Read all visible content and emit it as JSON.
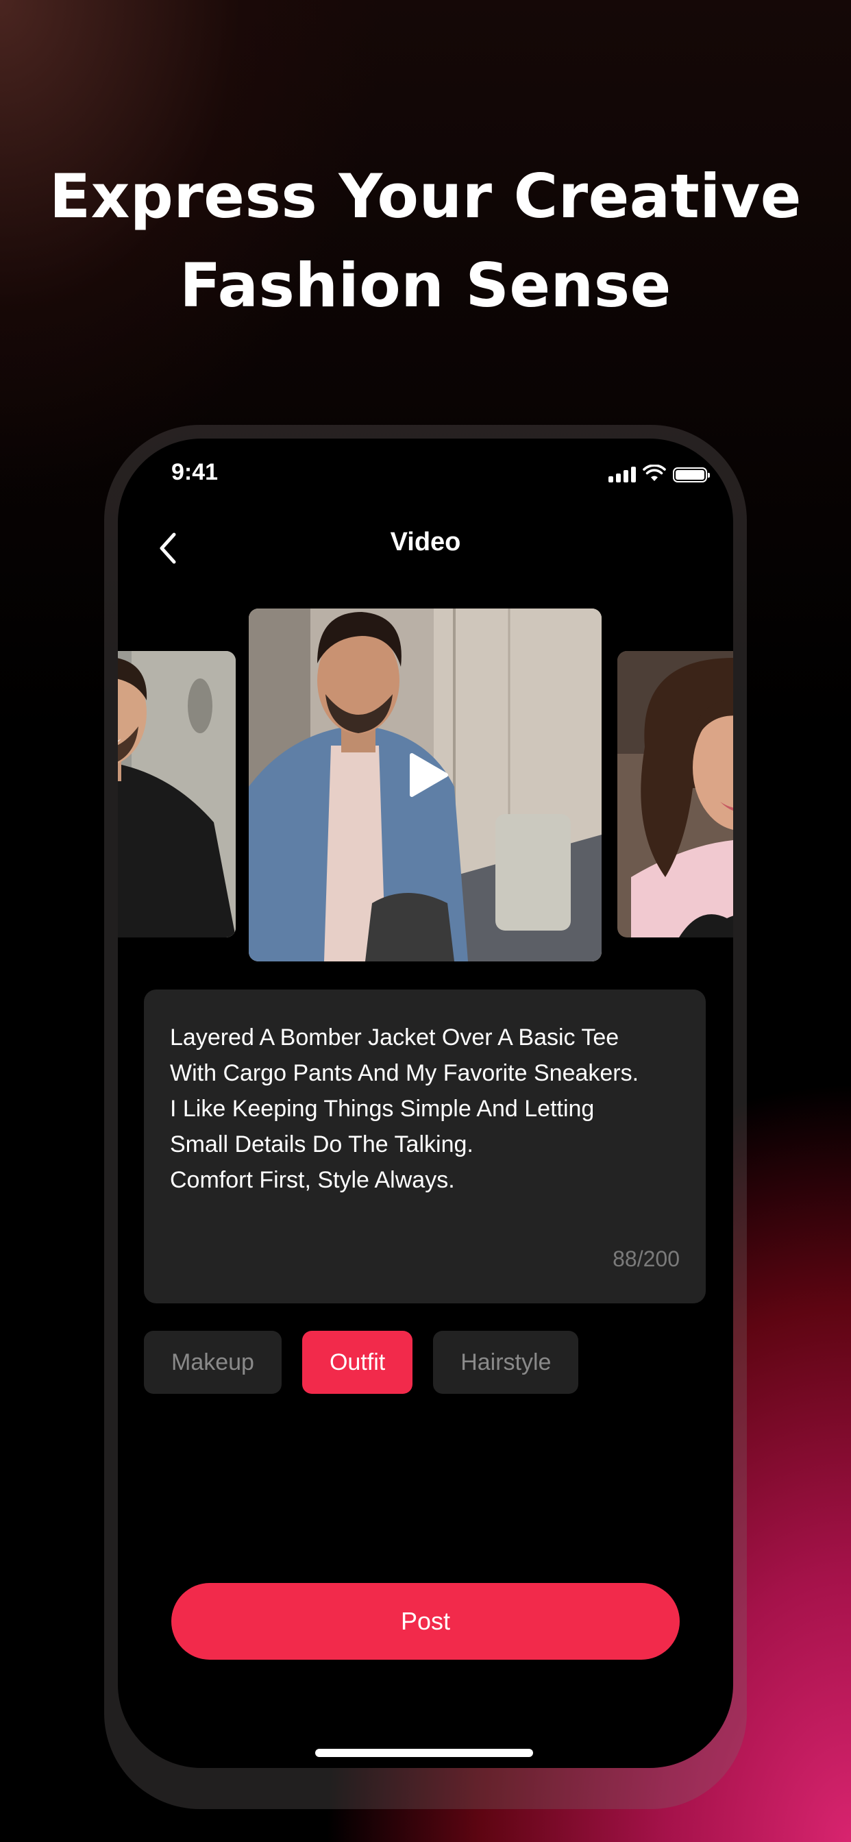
{
  "headline": {
    "line1": "Express Your Creative",
    "line2": "Fashion Sense"
  },
  "status_bar": {
    "time": "9:41",
    "icons": [
      "signal-icon",
      "wifi-icon",
      "battery-icon"
    ]
  },
  "nav": {
    "back_icon": "chevron-left-icon",
    "title": "Video"
  },
  "gallery": {
    "items": [
      {
        "name": "smiling-man-black-sweatshirt"
      },
      {
        "name": "man-denim-jacket-selfie-video",
        "overlay_icon": "play-icon"
      },
      {
        "name": "woman-curly-hair-pink-sweater"
      }
    ]
  },
  "description": {
    "text": "Layered A Bomber Jacket Over A Basic Tee\nWith Cargo Pants And My Favorite Sneakers.\nI Like Keeping Things Simple And Letting\nSmall Details Do The Talking.\nComfort First, Style Always.",
    "count": "88/200"
  },
  "categories": {
    "items": [
      {
        "label": "Makeup",
        "selected": false
      },
      {
        "label": "Outfit",
        "selected": true
      },
      {
        "label": "Hairstyle",
        "selected": false
      }
    ]
  },
  "post_button": {
    "label": "Post"
  },
  "colors": {
    "accent": "#f22a4b",
    "panel": "#232323",
    "muted_text": "#7b7b7b"
  }
}
